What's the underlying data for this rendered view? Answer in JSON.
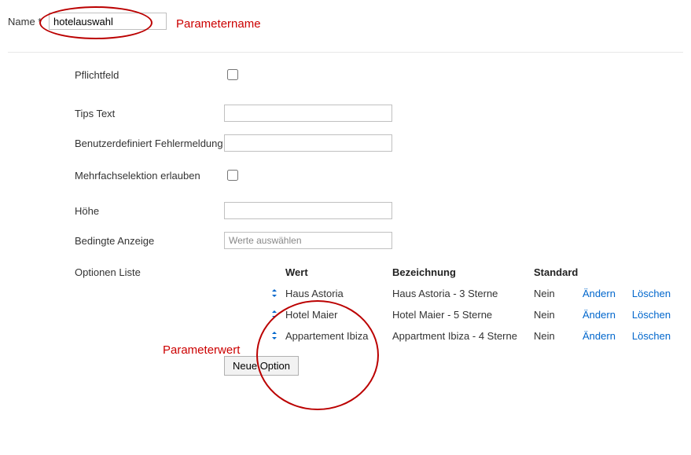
{
  "nameField": {
    "label": "Name *",
    "value": "hotelauswahl"
  },
  "annotations": {
    "parametername": "Parametername",
    "parameterwert": "Parameterwert"
  },
  "fields": {
    "pflichtfeld": {
      "label": "Pflichtfeld"
    },
    "tipsText": {
      "label": "Tips Text"
    },
    "customError": {
      "label": "Benutzerdefiniert Fehlermeldung"
    },
    "multiselect": {
      "label": "Mehrfachselektion erlauben"
    },
    "height": {
      "label": "Höhe"
    },
    "conditional": {
      "label": "Bedingte Anzeige",
      "placeholder": "Werte auswählen"
    },
    "optionsList": {
      "label": "Optionen Liste"
    }
  },
  "table": {
    "headers": {
      "wert": "Wert",
      "bezeichnung": "Bezeichnung",
      "standard": "Standard"
    },
    "actions": {
      "edit": "Ändern",
      "delete": "Löschen"
    },
    "rows": [
      {
        "wert": "Haus Astoria",
        "bezeichnung": "Haus Astoria - 3 Sterne",
        "standard": "Nein"
      },
      {
        "wert": "Hotel Maier",
        "bezeichnung": "Hotel Maier - 5 Sterne",
        "standard": "Nein"
      },
      {
        "wert": "Appartement Ibiza",
        "bezeichnung": "Appartment Ibiza - 4 Sterne",
        "standard": "Nein"
      }
    ]
  },
  "buttons": {
    "newOption": "Neue Option"
  }
}
